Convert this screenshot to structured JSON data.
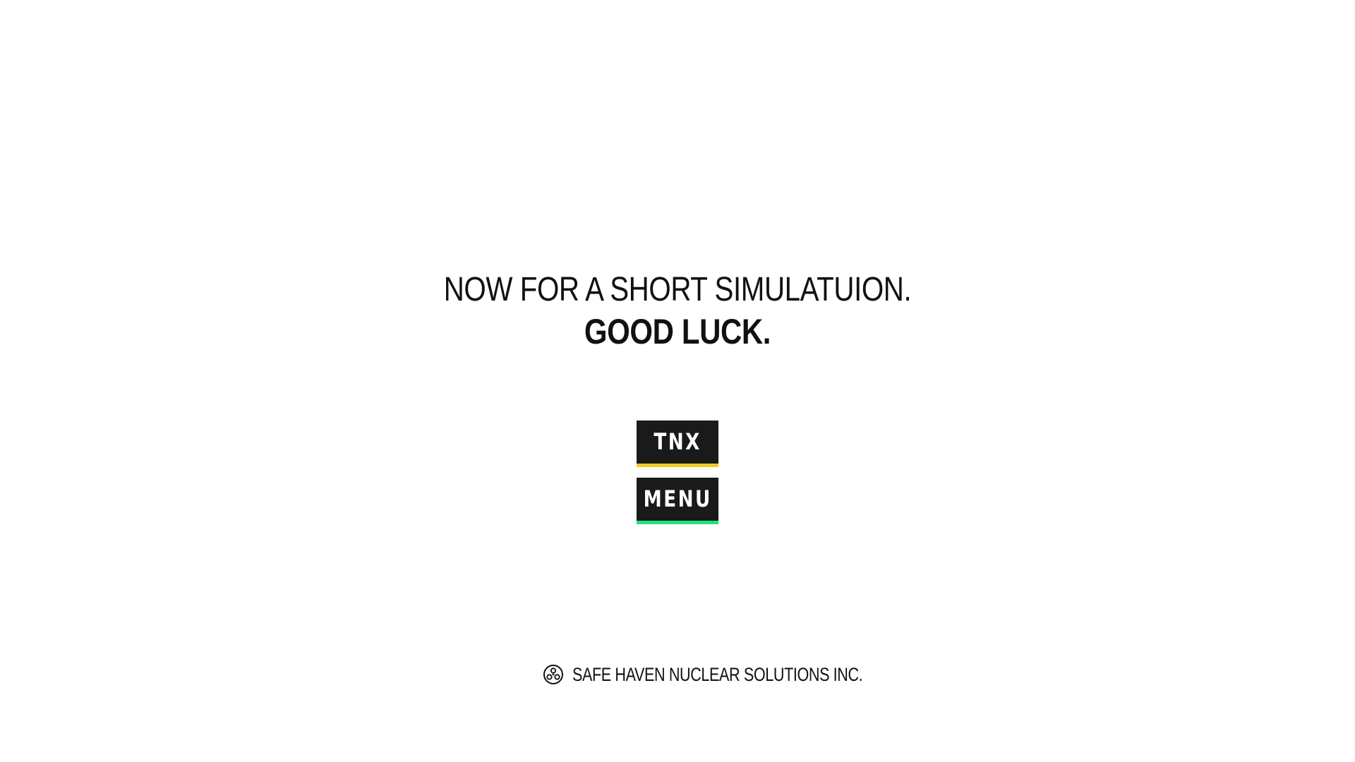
{
  "headline": {
    "line1": "NOW FOR A SHORT SIMULATUION.",
    "line2": "GOOD LUCK."
  },
  "buttons": {
    "tnx": {
      "label": "TNX",
      "accent": "#f4cc1f"
    },
    "menu": {
      "label": "MENU",
      "accent": "#20e37c"
    }
  },
  "footer": {
    "icon": "radiation-icon",
    "text": "SAFE HAVEN NUCLEAR SOLUTIONS INC."
  },
  "colors": {
    "background": "#ffffff",
    "text": "#111111",
    "button_bg": "#1a1a1a"
  }
}
